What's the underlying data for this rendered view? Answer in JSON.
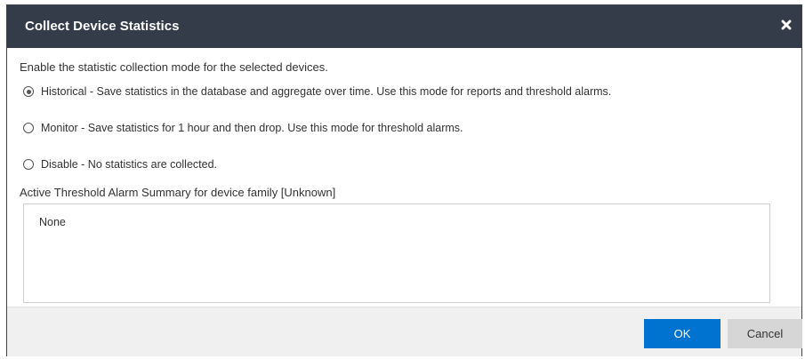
{
  "dialog": {
    "title": "Collect Device Statistics",
    "close_icon": "close-icon",
    "intro": "Enable the statistic collection mode for the selected devices.",
    "modes": [
      {
        "label": "Historical - Save statistics in the database and aggregate over time. Use this mode for reports and threshold alarms.",
        "selected": true
      },
      {
        "label": "Monitor - Save statistics for 1 hour and then drop. Use this mode for threshold alarms.",
        "selected": false
      },
      {
        "label": "Disable - No statistics are collected.",
        "selected": false
      }
    ],
    "summary_label": "Active Threshold Alarm Summary for device family [Unknown]",
    "summary_text": "None",
    "ok_label": "OK",
    "cancel_label": "Cancel"
  },
  "colors": {
    "titlebar": "#343c49",
    "ok_button": "#0073d1",
    "cancel_button": "#d6d6d6",
    "footer": "#f0f0f0"
  }
}
